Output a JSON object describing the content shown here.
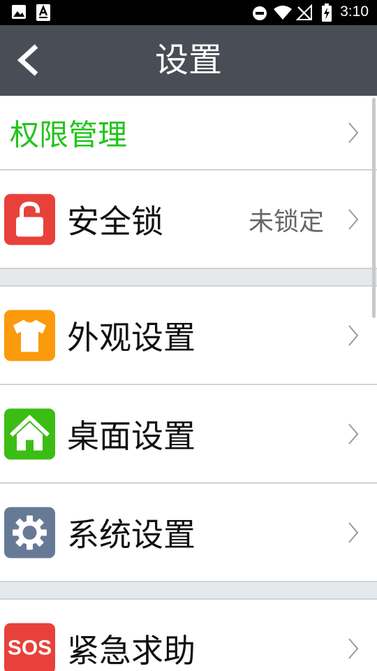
{
  "status_bar": {
    "time": "3:10",
    "icons": [
      "image-icon",
      "text-a-icon",
      "do-not-disturb-icon",
      "wifi-icon",
      "no-signal-icon",
      "battery-charging-icon"
    ]
  },
  "header": {
    "title": "设置",
    "back_icon": "chevron-left-icon"
  },
  "list": {
    "permission": {
      "label": "权限管理",
      "color": "#22c41a"
    },
    "security_lock": {
      "label": "安全锁",
      "value": "未锁定",
      "icon": "lock-icon",
      "icon_color": "#e8413c"
    },
    "appearance": {
      "label": "外观设置",
      "icon": "tshirt-icon",
      "icon_color": "#fb9a0c"
    },
    "desktop": {
      "label": "桌面设置",
      "icon": "home-icon",
      "icon_color": "#3bbd14"
    },
    "system": {
      "label": "系统设置",
      "icon": "gear-icon",
      "icon_color": "#667a96"
    },
    "sos": {
      "label": "紧急求助",
      "icon_text": "SOS",
      "icon": "sos-icon",
      "icon_color": "#e8413c"
    }
  }
}
